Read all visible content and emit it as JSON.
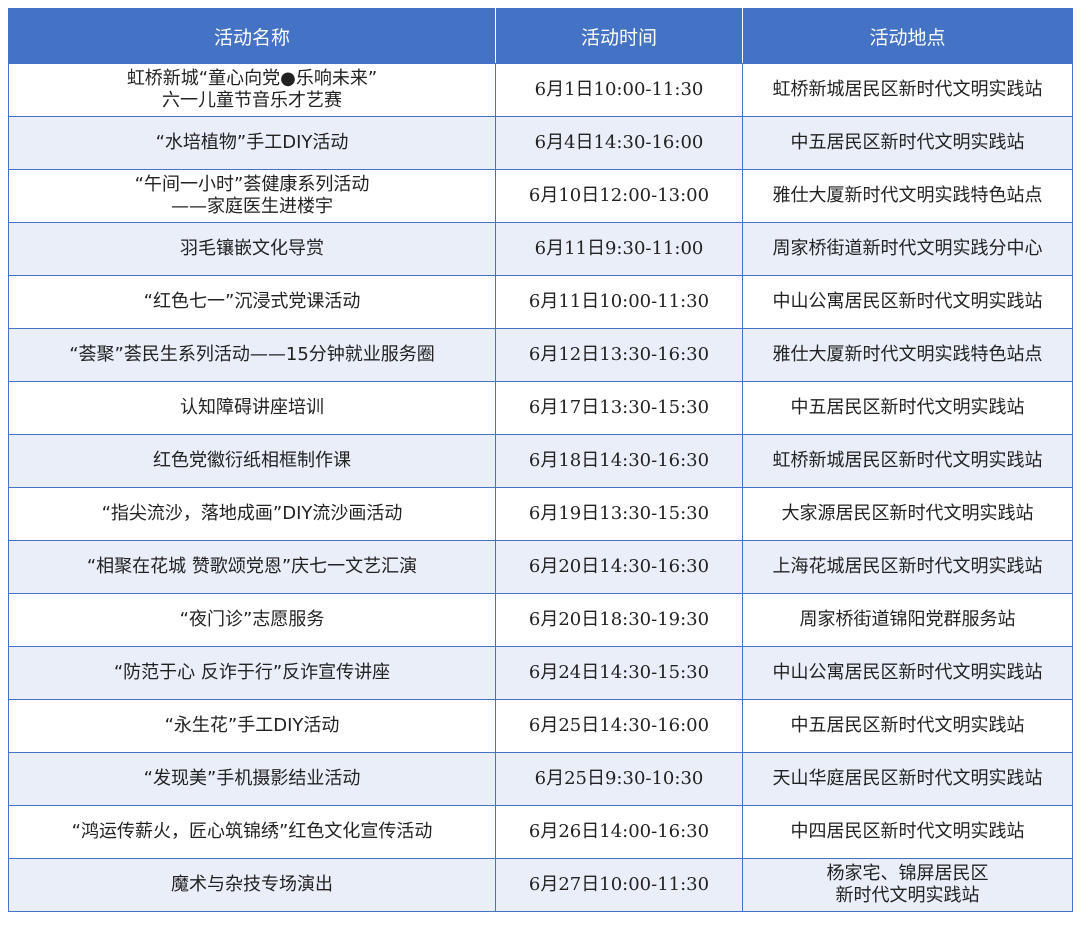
{
  "header": {
    "col_name": "活动名称",
    "col_time": "活动时间",
    "col_place": "活动地点"
  },
  "rows": [
    {
      "name": [
        "虹桥新城“童心向党●乐响未来”",
        "六一儿童节音乐才艺赛"
      ],
      "time": "6月1日10:00-11:30",
      "place": [
        "虹桥新城居民区新时代文明实践站"
      ]
    },
    {
      "name": [
        "“水培植物”手工DIY活动"
      ],
      "time": "6月4日14:30-16:00",
      "place": [
        "中五居民区新时代文明实践站"
      ]
    },
    {
      "name": [
        "“午间一小时”荟健康系列活动",
        "——家庭医生进楼宇"
      ],
      "time": "6月10日12:00-13:00",
      "place": [
        "雅仕大厦新时代文明实践特色站点"
      ]
    },
    {
      "name": [
        "羽毛镶嵌文化导赏"
      ],
      "time": "6月11日9:30-11:00",
      "place": [
        "周家桥街道新时代文明实践分中心"
      ]
    },
    {
      "name": [
        "“红色七一”沉浸式党课活动"
      ],
      "time": "6月11日10:00-11:30",
      "place": [
        "中山公寓居民区新时代文明实践站"
      ]
    },
    {
      "name": [
        "“荟聚”荟民生系列活动——15分钟就业服务圈"
      ],
      "time": "6月12日13:30-16:30",
      "place": [
        "雅仕大厦新时代文明实践特色站点"
      ]
    },
    {
      "name": [
        "认知障碍讲座培训"
      ],
      "time": "6月17日13:30-15:30",
      "place": [
        "中五居民区新时代文明实践站"
      ]
    },
    {
      "name": [
        "红色党徽衍纸相框制作课"
      ],
      "time": "6月18日14:30-16:30",
      "place": [
        "虹桥新城居民区新时代文明实践站"
      ]
    },
    {
      "name": [
        "“指尖流沙，落地成画”DIY流沙画活动"
      ],
      "time": "6月19日13:30-15:30",
      "place": [
        "大家源居民区新时代文明实践站"
      ]
    },
    {
      "name": [
        "“相聚在花城 赞歌颂党恩”庆七一文艺汇演"
      ],
      "time": "6月20日14:30-16:30",
      "place": [
        "上海花城居民区新时代文明实践站"
      ]
    },
    {
      "name": [
        "“夜门诊”志愿服务"
      ],
      "time": "6月20日18:30-19:30",
      "place": [
        "周家桥街道锦阳党群服务站"
      ]
    },
    {
      "name": [
        "“防范于心 反诈于行”反诈宣传讲座"
      ],
      "time": "6月24日14:30-15:30",
      "place": [
        "中山公寓居民区新时代文明实践站"
      ]
    },
    {
      "name": [
        "“永生花”手工DIY活动"
      ],
      "time": "6月25日14:30-16:00",
      "place": [
        "中五居民区新时代文明实践站"
      ]
    },
    {
      "name": [
        "“发现美”手机摄影结业活动"
      ],
      "time": "6月25日9:30-10:30",
      "place": [
        "天山华庭居民区新时代文明实践站"
      ]
    },
    {
      "name": [
        "“鸿运传薪火，匠心筑锦绣”红色文化宣传活动"
      ],
      "time": "6月26日14:00-16:30",
      "place": [
        "中四居民区新时代文明实践站"
      ]
    },
    {
      "name": [
        "魔术与杂技专场演出"
      ],
      "time": "6月27日10:00-11:30",
      "place": [
        "杨家宅、锦屏居民区",
        "新时代文明实践站"
      ]
    }
  ],
  "colors": {
    "header_bg": "#4472c4",
    "stripe_bg": "#e9eef8",
    "border": "#4472c4"
  }
}
